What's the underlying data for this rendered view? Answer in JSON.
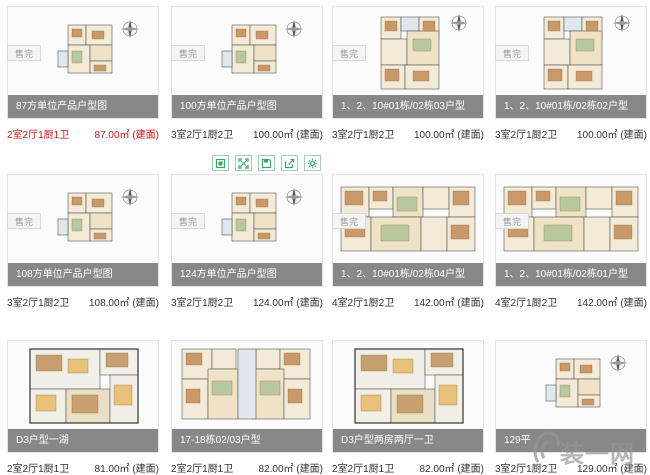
{
  "accent_color": "#c8161d",
  "toolbar_color": "#3aa66a",
  "toolbar_icons": [
    "original-image-icon",
    "fullscreen-icon",
    "save-icon",
    "share-icon",
    "settings-icon"
  ],
  "cards": [
    {
      "caption": "87方单位产品户型图",
      "rooms": "2室2厅1厨1卫",
      "area": "87.00㎡ (建面)",
      "status": "售完",
      "highlight": true,
      "plan": "small"
    },
    {
      "caption": "100方单位产品户型图",
      "rooms": "3室2厅1厨2卫",
      "area": "100.00㎡ (建面)",
      "status": "售完",
      "highlight": false,
      "plan": "small"
    },
    {
      "caption": "1、2、10#01栋/02栋03户型",
      "rooms": "3室2厅1厨2卫",
      "area": "100.00㎡ (建面)",
      "status": "售完",
      "highlight": false,
      "plan": "tall"
    },
    {
      "caption": "1、2、10#01栋/02栋02户型",
      "rooms": "3室2厅1厨2卫",
      "area": "100.00㎡ (建面)",
      "status": "售完",
      "highlight": false,
      "plan": "tall"
    },
    {
      "caption": "108方单位产品户型图",
      "rooms": "3室2厅1厨2卫",
      "area": "108.00㎡ (建面)",
      "status": "售完",
      "highlight": false,
      "plan": "small"
    },
    {
      "caption": "124方单位产品户型图",
      "rooms": "3室2厅1厨2卫",
      "area": "124.00㎡ (建面)",
      "status": "售完",
      "highlight": false,
      "plan": "small"
    },
    {
      "caption": "1、2、10#01栋/02栋04户型",
      "rooms": "4室2厅1厨2卫",
      "area": "142.00㎡ (建面)",
      "status": "售完",
      "highlight": false,
      "plan": "wide"
    },
    {
      "caption": "1、2、10#01栋/02栋01户型",
      "rooms": "4室2厅1厨2卫",
      "area": "142.00㎡ (建面)",
      "status": "售完",
      "highlight": false,
      "plan": "wide"
    },
    {
      "caption": "D3户型一湖",
      "rooms": "2室2厅1厨1卫",
      "area": "81.00㎡ (建面)",
      "status": "",
      "highlight": false,
      "plan": "color"
    },
    {
      "caption": "17-18栋02/03户型",
      "rooms": "2室2厅1厨1卫",
      "area": "82.00㎡ (建面)",
      "status": "",
      "highlight": false,
      "plan": "double"
    },
    {
      "caption": "D3户型两房两厅一卫",
      "rooms": "2室2厅1厨1卫",
      "area": "82.00㎡ (建面)",
      "status": "",
      "highlight": false,
      "plan": "color"
    },
    {
      "caption": "129平",
      "rooms": "3室2厅1厨2卫",
      "area": "129.00㎡ (建面)",
      "status": "",
      "highlight": false,
      "plan": "small"
    }
  ],
  "watermark": {
    "text": "装一网"
  }
}
